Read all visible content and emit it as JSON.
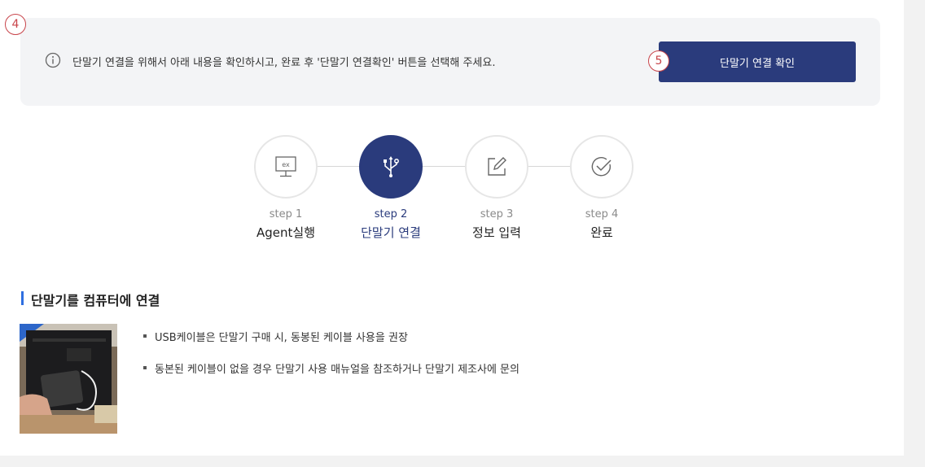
{
  "callouts": {
    "notice": "4",
    "button": "5"
  },
  "notice": {
    "text": "단말기 연결을 위해서 아래 내용을 확인하시고, 완료 후 '단말기 연결확인' 버튼을 선택해 주세요.",
    "button_label": "단말기 연결 확인"
  },
  "steps": [
    {
      "num": "step 1",
      "title": "Agent실행",
      "icon": "monitor-ex-icon"
    },
    {
      "num": "step 2",
      "title": "단말기 연결",
      "icon": "usb-icon"
    },
    {
      "num": "step 3",
      "title": "정보 입력",
      "icon": "edit-icon"
    },
    {
      "num": "step 4",
      "title": "완료",
      "icon": "check-circle-icon"
    }
  ],
  "active_step": "step 2",
  "section": {
    "title": "단말기를 컴퓨터에 연결",
    "bullets": [
      "USB케이블은 단말기 구매 시, 동봉된 케이블 사용을 권장",
      "동본된 케이블이 없을 경우 단말기 사용 매뉴얼을 참조하거나 단말기 제조사에 문의"
    ]
  },
  "colors": {
    "accent": "#2a3b7c",
    "badge": "#c8444a",
    "section_bar": "#2f6fe0"
  }
}
